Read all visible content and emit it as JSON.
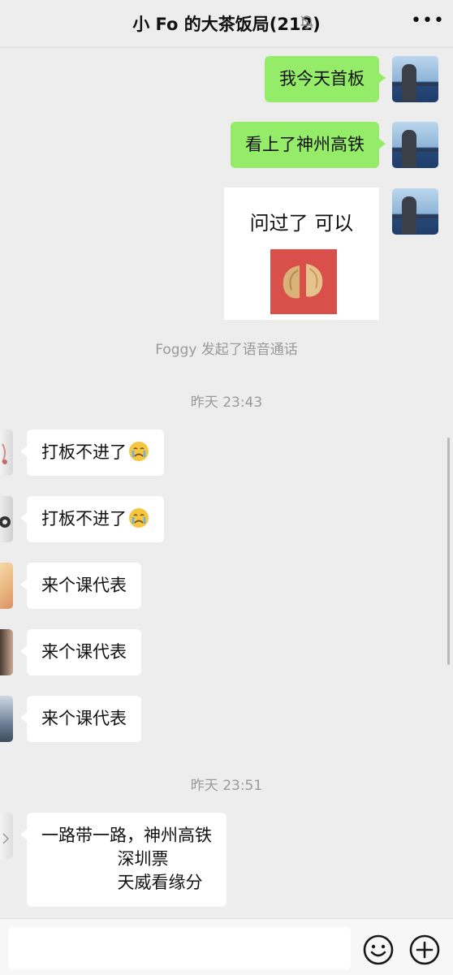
{
  "header": {
    "title": "小 Fo 的大茶饭局(212)",
    "mute_icon": "bell-off-icon",
    "more_icon": "more-dots-icon",
    "more_label": "•••"
  },
  "messages_out": [
    {
      "text": "我今天首板"
    },
    {
      "text": "看上了神州高铁"
    }
  ],
  "sticker": {
    "caption": "问过了 可以",
    "image": "cracked-wooden-cup-image"
  },
  "system_note": "Foggy 发起了语音通话",
  "timestamps": [
    "昨天 23:43",
    "昨天 23:51"
  ],
  "messages_in": [
    {
      "text": "打板不进了",
      "emoji": "crying-face-icon"
    },
    {
      "text": "打板不进了",
      "emoji": "crying-face-icon"
    },
    {
      "text": "来个课代表"
    },
    {
      "text": "来个课代表"
    },
    {
      "text": "来个课代表"
    }
  ],
  "multiline_message": {
    "lines": [
      "一路带一路，神州高铁",
      "              深圳票",
      "              天威看缘分"
    ]
  },
  "input": {
    "value": "",
    "placeholder": ""
  },
  "toolbar": {
    "emoji_icon": "smiley-icon",
    "plus_icon": "plus-circle-icon"
  },
  "colors": {
    "outgoing_bubble": "#95ec69",
    "incoming_bubble": "#ffffff",
    "background": "#ededed"
  }
}
